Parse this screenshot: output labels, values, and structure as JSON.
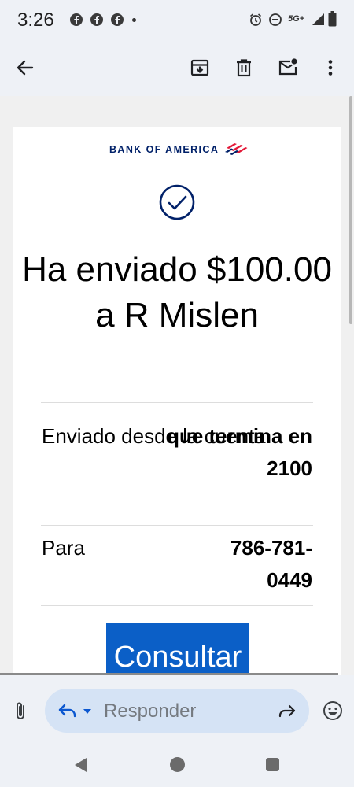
{
  "status_bar": {
    "time": "3:26",
    "notification_icons": [
      "facebook-icon",
      "facebook-icon",
      "facebook-icon"
    ],
    "network": "5G+",
    "system_icons": [
      "alarm-icon",
      "do-not-disturb-icon",
      "signal-icon",
      "battery-icon"
    ]
  },
  "app_bar": {
    "icons": [
      "back-arrow-icon",
      "archive-icon",
      "delete-icon",
      "mark-unread-icon",
      "more-vert-icon"
    ]
  },
  "email": {
    "brand": "BANK OF AMERICA",
    "headline": "Ha enviado $100.00 a R Mislen",
    "rows": [
      {
        "label": "Enviado desde la cuenta",
        "value": "que termina en 2100"
      },
      {
        "label": "Para",
        "value": "786-781-0449"
      }
    ],
    "button_label": "Consultar",
    "colors": {
      "brand_navy": "#012169",
      "brand_red": "#e31837",
      "button_blue": "#0b5fc7"
    }
  },
  "reply_bar": {
    "placeholder": "Responder",
    "field_color": "#d5e3f5"
  },
  "nav_bar": {
    "icons": [
      "nav-back-icon",
      "nav-home-icon",
      "nav-recents-icon"
    ]
  }
}
